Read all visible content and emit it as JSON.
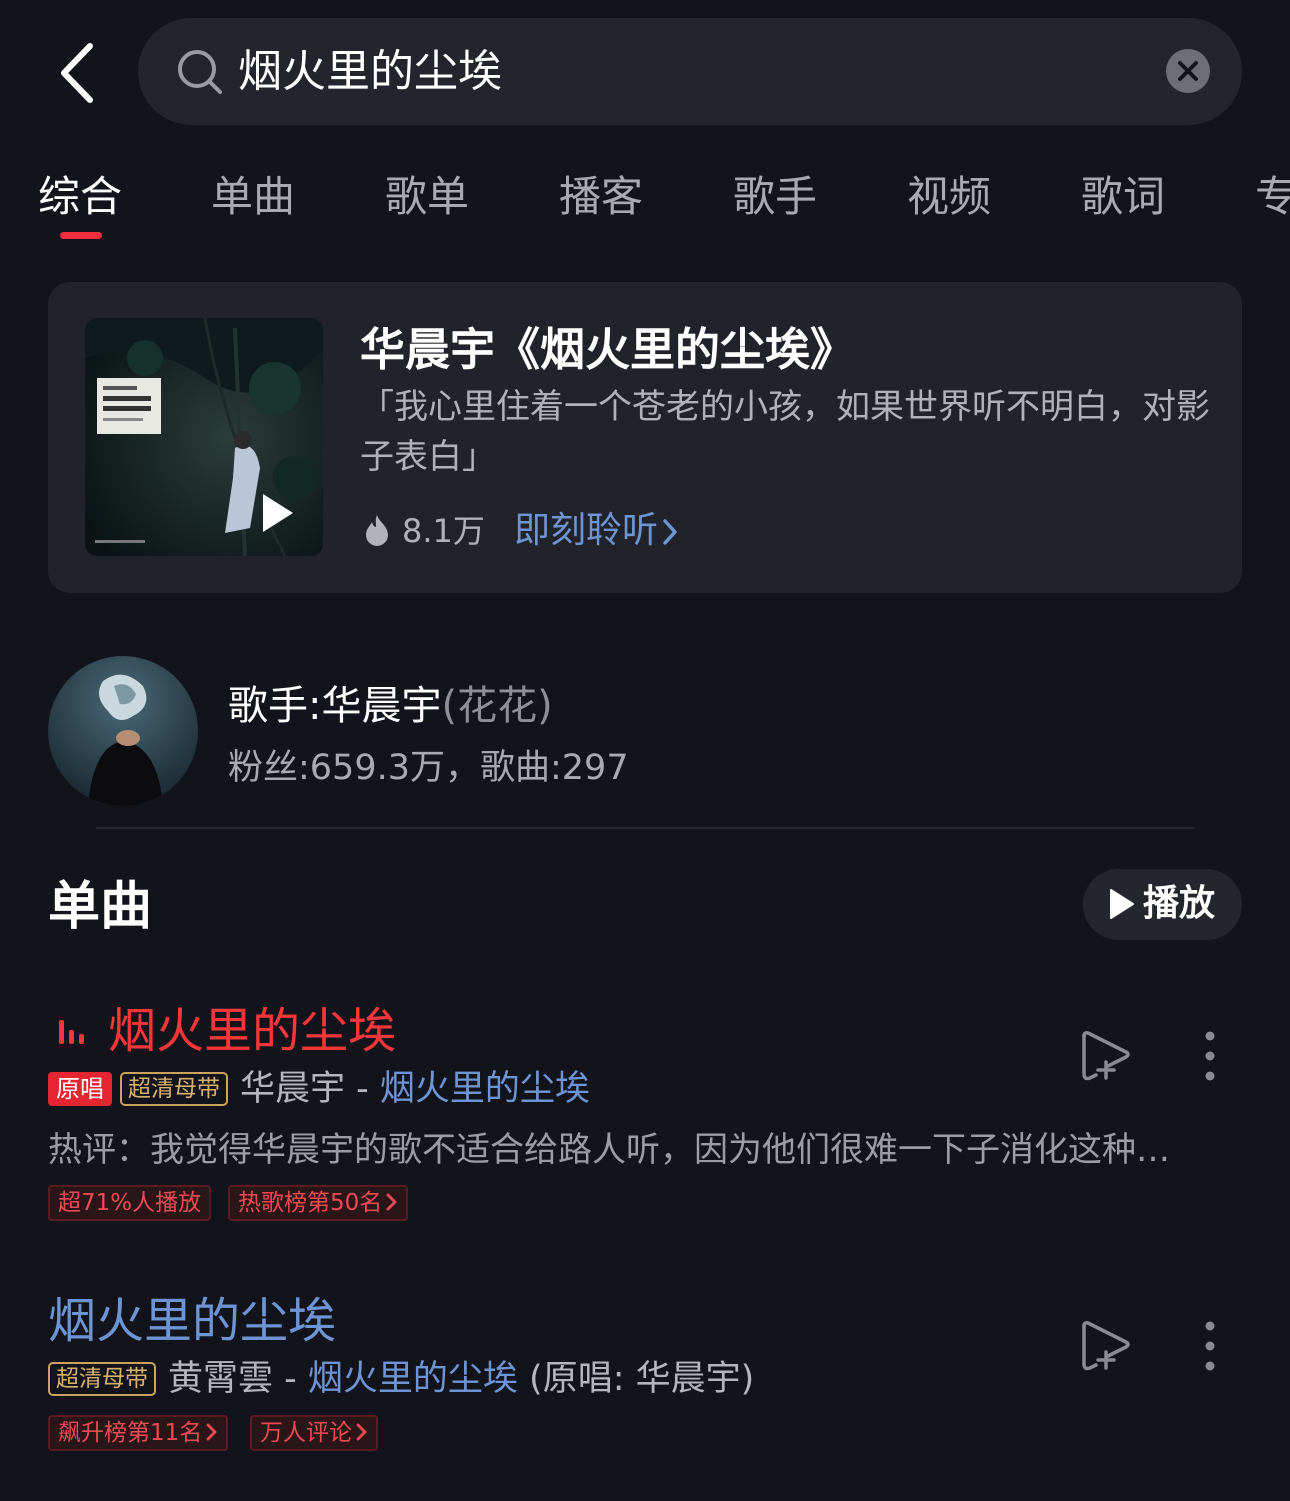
{
  "search": {
    "query": "烟火里的尘埃"
  },
  "tabs": [
    "综合",
    "单曲",
    "歌单",
    "播客",
    "歌手",
    "视频",
    "歌词",
    "专"
  ],
  "album_card": {
    "title": "华晨宇《烟火里的尘埃》",
    "quote": "「我心里住着一个苍老的小孩，如果世界听不明白，对影子表白」",
    "heat": "8.1万",
    "listen_label": "即刻聆听"
  },
  "artist": {
    "name": "歌手:华晨宇",
    "alias": "(花花)",
    "stats": "粉丝:659.3万，歌曲:297"
  },
  "singles": {
    "title": "单曲",
    "play_label": "播放",
    "songs": [
      {
        "title": "烟火里的尘埃",
        "badge_original": "原唱",
        "badge_quality": "超清母带",
        "artist": "华晨宇",
        "sep": " - ",
        "album": "烟火里的尘埃",
        "hot_comment": "热评：我觉得华晨宇的歌不适合给路人听，因为他们很难一下子消化这种…",
        "chips": [
          "超71%人播放",
          "热歌榜第50名"
        ]
      },
      {
        "title": "烟火里的尘埃",
        "badge_quality": "超清母带",
        "artist": "黄霄雲",
        "sep": " - ",
        "album": "烟火里的尘埃",
        "original_note": " (原唱: 华晨宇)",
        "chips": [
          "飙升榜第11名",
          "万人评论"
        ]
      }
    ]
  },
  "colors": {
    "background": "#13131b",
    "accent_red": "#f02d3c",
    "link_blue": "#6d95d3",
    "gold": "#caa45e"
  },
  "icons": [
    "back-arrow-icon",
    "search-icon",
    "clear-icon",
    "play-icon",
    "fire-icon",
    "chevron-right-icon",
    "equalizer-icon",
    "add-to-playlist-icon",
    "more-vertical-icon"
  ]
}
